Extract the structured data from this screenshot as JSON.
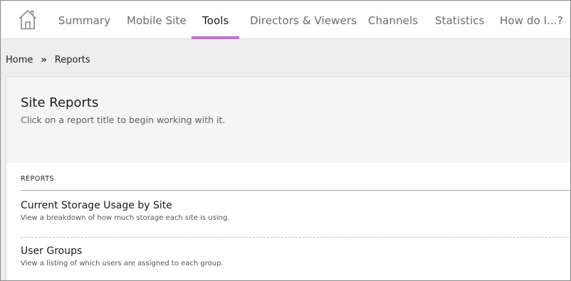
{
  "nav": {
    "home_icon": "home-icon",
    "tabs": [
      {
        "label": "Summary",
        "active": false
      },
      {
        "label": "Mobile Site",
        "active": false
      },
      {
        "label": "Tools",
        "active": true
      },
      {
        "label": "Directors & Viewers",
        "active": false
      },
      {
        "label": "Channels",
        "active": false
      },
      {
        "label": "Statistics",
        "active": false
      },
      {
        "label": "How do I...?",
        "active": false
      }
    ],
    "active_color": "#c66fd1"
  },
  "breadcrumb": {
    "items": [
      "Home",
      "Reports"
    ],
    "separator": "»"
  },
  "page": {
    "title": "Site Reports",
    "subtitle": "Click on a report title to begin working with it."
  },
  "reports": {
    "section_label": "REPORTS",
    "items": [
      {
        "title": "Current Storage Usage by Site",
        "description": "View a breakdown of how much storage each site is using."
      },
      {
        "title": "User Groups",
        "description": "View a listing of which users are assigned to each group."
      }
    ]
  }
}
